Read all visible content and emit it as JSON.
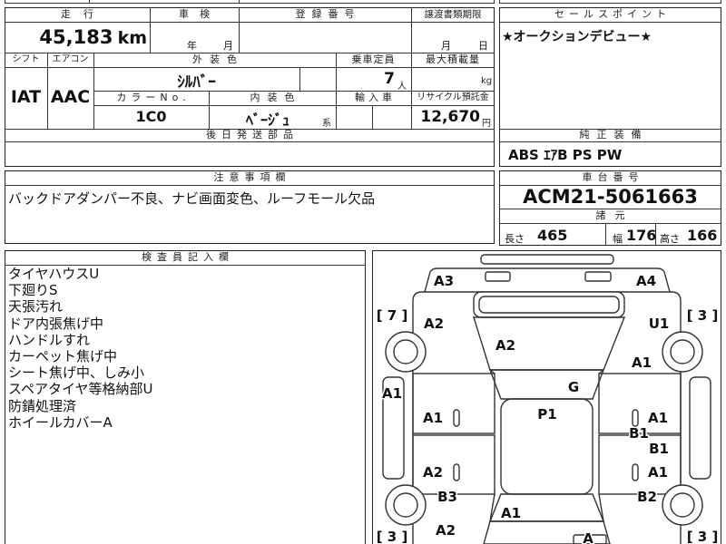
{
  "sheet_info": {
    "mileage": {
      "label": "走行",
      "value": "45,183",
      "unit": "km"
    },
    "inspection": {
      "label": "車検",
      "year_unit": "年",
      "month_unit": "月"
    },
    "registration": {
      "label": "登録番号"
    },
    "transfer_deadline": {
      "label": "譲渡書類期限",
      "month_unit": "月",
      "day_unit": "日"
    },
    "shift": {
      "label": "シフト",
      "value": "IAT"
    },
    "aircon": {
      "label": "エアコン",
      "value": "AAC"
    },
    "exterior_color": {
      "label": "外装色",
      "value": "ｼﾙﾊﾞｰ"
    },
    "seating_capacity": {
      "label": "乗車定員",
      "value": "7",
      "unit": "人"
    },
    "max_load": {
      "label": "最大積載量",
      "unit": "kg"
    },
    "color_no": {
      "label": "カラーNo.",
      "value": "1C0"
    },
    "interior_color": {
      "label": "内装色",
      "value": "ﾍﾞｰｼﾞｭ",
      "suffix": "系"
    },
    "imported": {
      "label": "輸入車"
    },
    "recycle_deposit": {
      "label": "リサイクル預託金",
      "value": "12,670",
      "unit": "円"
    },
    "later_shipped_parts": {
      "label": "後日発送部品"
    }
  },
  "sales_point": {
    "label": "セールスポイント",
    "value": "★オークションデビュー★"
  },
  "standard_equipment": {
    "label": "純正装備",
    "value": "ABS ｴｱB PS PW"
  },
  "notes": {
    "label": "注意事項欄",
    "value": "バックドアダンパー不良、ナビ画面変色、ルーフモール欠品"
  },
  "chassis_number": {
    "label": "車台番号",
    "value": "ACM21-5061663"
  },
  "specifications": {
    "label": "諸元",
    "dimensions": [
      {
        "label": "長さ",
        "value": "465"
      },
      {
        "label": "幅",
        "value": "176"
      },
      {
        "label": "高さ",
        "value": "166"
      }
    ]
  },
  "inspector_notes": {
    "label": "検査員記入欄",
    "lines": [
      "タイヤハウスU",
      "下廻りS",
      "天張汚れ",
      "ドア内張焦げ中",
      "ハンドルすれ",
      "カーペット焦げ中",
      "シート焦げ中、しみ小",
      "スペアタイヤ等格納部U",
      "防錆処理済",
      "ホイールカバーA"
    ]
  },
  "damage_diagram": {
    "marks": [
      "A3",
      "A4",
      "[ 7 ]",
      "[ 3 ]",
      "A2",
      "U1",
      "A2",
      "A1",
      "A1",
      "G",
      "A1",
      "P1",
      "A1",
      "B1",
      "B1",
      "A2",
      "A1",
      "B3",
      "B2",
      "A1",
      "A2",
      "[ 3 ]",
      "[ 3 ]",
      "A"
    ]
  }
}
